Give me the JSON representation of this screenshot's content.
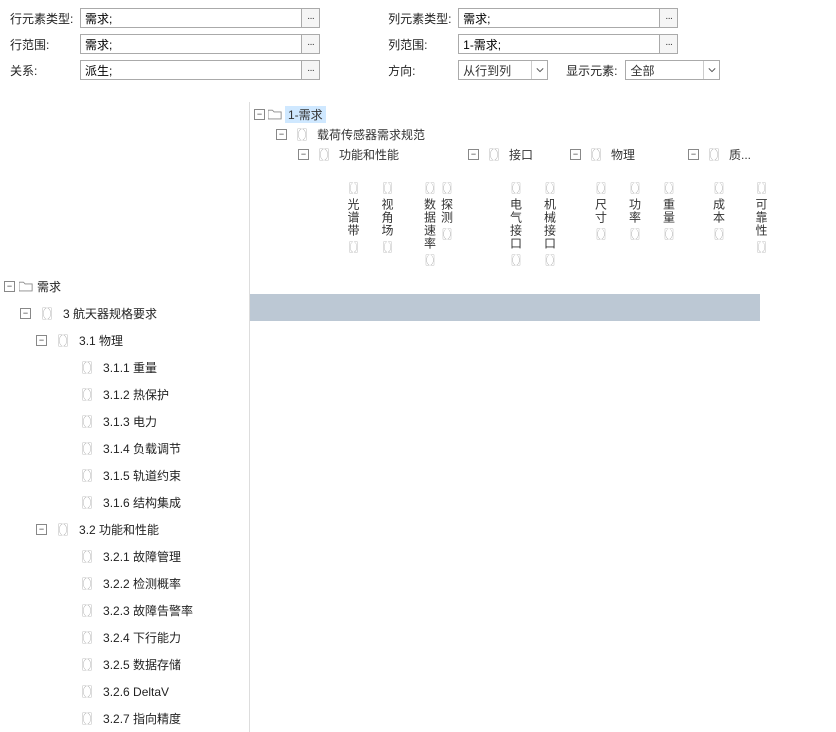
{
  "filters": {
    "rowElementType": {
      "label": "行元素类型:",
      "value": "需求;"
    },
    "colElementType": {
      "label": "列元素类型:",
      "value": "需求;"
    },
    "rowScope": {
      "label": "行范围:",
      "value": "需求;"
    },
    "colScope": {
      "label": "列范围:",
      "value": "1-需求;"
    },
    "relation": {
      "label": "关系:",
      "value": "派生;"
    },
    "direction": {
      "label": "方向:",
      "value": "从行到列"
    },
    "displayElem": {
      "label": "显示元素:",
      "value": "全部"
    },
    "ellipsis": "···"
  },
  "colTree": {
    "root": "1-需求",
    "spec": "载荷传感器需求规范",
    "groups": {
      "func": "功能和性能",
      "iface": "接口",
      "phys": "物理",
      "qual": "质..."
    },
    "leaves": {
      "spectrum": "光谱带",
      "fov": "视角场",
      "datarate": "数据速率",
      "detect": "探测",
      "eiface": "电气接口",
      "miface": "机械接口",
      "size": "尺寸",
      "power": "功率",
      "weight": "重量",
      "cost": "成本",
      "reliab": "可靠性"
    }
  },
  "rowTree": {
    "root": "需求",
    "items": [
      {
        "num": "3",
        "label": "航天器规格要求",
        "depth": 1,
        "toggle": "-",
        "shaded": true
      },
      {
        "num": "3.1",
        "label": "物理",
        "depth": 2,
        "toggle": "-"
      },
      {
        "num": "3.1.1",
        "label": "重量",
        "depth": 3
      },
      {
        "num": "3.1.2",
        "label": "热保护",
        "depth": 3
      },
      {
        "num": "3.1.3",
        "label": "电力",
        "depth": 3
      },
      {
        "num": "3.1.4",
        "label": "负载调节",
        "depth": 3
      },
      {
        "num": "3.1.5",
        "label": "轨道约束",
        "depth": 3
      },
      {
        "num": "3.1.6",
        "label": "结构集成",
        "depth": 3
      },
      {
        "num": "3.2",
        "label": "功能和性能",
        "depth": 2,
        "toggle": "-"
      },
      {
        "num": "3.2.1",
        "label": "故障管理",
        "depth": 3
      },
      {
        "num": "3.2.2",
        "label": "检测概率",
        "depth": 3
      },
      {
        "num": "3.2.3",
        "label": "故障告警率",
        "depth": 3
      },
      {
        "num": "3.2.4",
        "label": "下行能力",
        "depth": 3
      },
      {
        "num": "3.2.5",
        "label": "数据存储",
        "depth": 3
      },
      {
        "num": "3.2.6",
        "label": "DeltaV",
        "depth": 3
      },
      {
        "num": "3.2.7",
        "label": "指向精度",
        "depth": 3
      }
    ]
  },
  "toggle": {
    "minus": "−",
    "plus": "+"
  },
  "bracket": {
    "open": "〖",
    "close": "〗",
    "pair": "〖〗"
  }
}
